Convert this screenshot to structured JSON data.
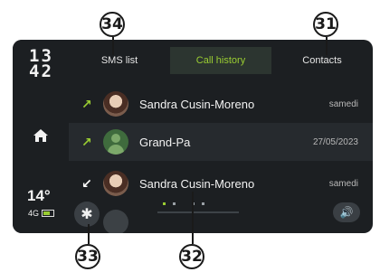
{
  "callouts": {
    "sms": "34",
    "contacts": "31",
    "settings": "33",
    "list": "32"
  },
  "status": {
    "time": "13\n42",
    "temperature": "14°",
    "network": "4G"
  },
  "tabs": [
    {
      "label": "SMS list",
      "active": false
    },
    {
      "label": "Call history",
      "active": true
    },
    {
      "label": "Contacts",
      "active": false
    }
  ],
  "calls": [
    {
      "direction": "outgoing",
      "direction_glyph": "↗",
      "name": "Sandra Cusin-Moreno",
      "date": "samedi",
      "avatar": "photo"
    },
    {
      "direction": "outgoing",
      "direction_glyph": "↗",
      "name": "Grand-Pa",
      "date": "27/05/2023",
      "avatar": "generic"
    },
    {
      "direction": "incoming",
      "direction_glyph": "↙",
      "name": "Sandra Cusin-Moreno",
      "date": "samedi",
      "avatar": "photo"
    }
  ],
  "colors": {
    "accent": "#9acd32",
    "outgoing": "#9acd32",
    "incoming": "#ffffff",
    "background": "#1c1f22"
  },
  "icons": {
    "home": "home-icon",
    "settings": "gear-icon",
    "volume": "speaker-icon"
  }
}
